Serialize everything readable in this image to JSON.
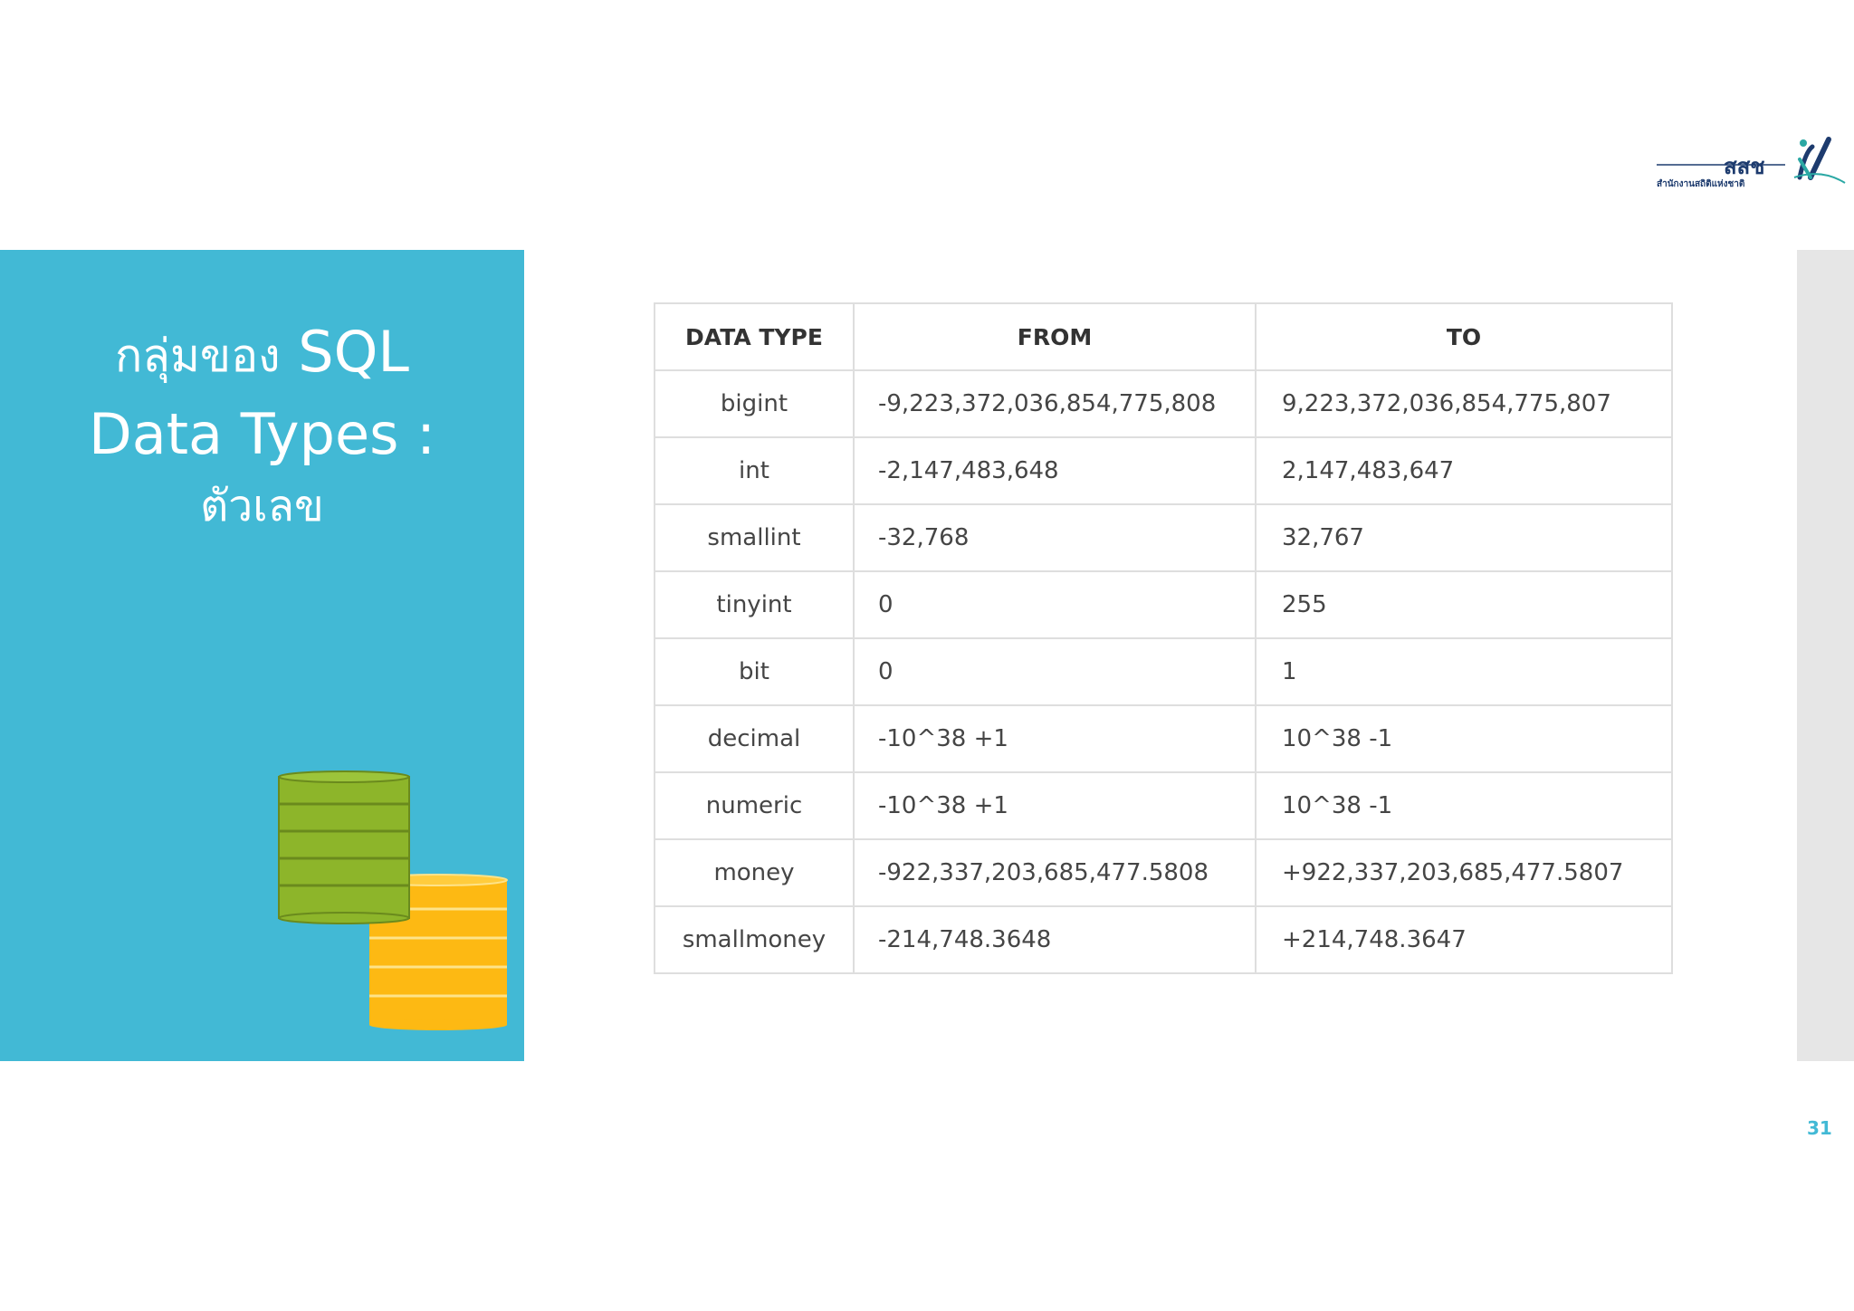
{
  "logo": {
    "text": "สสช",
    "subtitle": "สำนักงานสถิติแห่งชาติ",
    "icon": "nso-logo-icon"
  },
  "title": {
    "line1_thai": "กลุ่มของ",
    "line1_en": "SQL",
    "line2": "Data Types :",
    "line3": "ตัวเลข"
  },
  "table": {
    "headers": [
      "DATA TYPE",
      "FROM",
      "TO"
    ],
    "rows": [
      {
        "type": "bigint",
        "from": "-9,223,372,036,854,775,808",
        "to": "9,223,372,036,854,775,807"
      },
      {
        "type": "int",
        "from": "-2,147,483,648",
        "to": "2,147,483,647"
      },
      {
        "type": "smallint",
        "from": "-32,768",
        "to": "32,767"
      },
      {
        "type": "tinyint",
        "from": "0",
        "to": "255"
      },
      {
        "type": "bit",
        "from": "0",
        "to": "1"
      },
      {
        "type": "decimal",
        "from": "-10^38 +1",
        "to": "10^38 -1"
      },
      {
        "type": "numeric",
        "from": "-10^38 +1",
        "to": "10^38 -1"
      },
      {
        "type": "money",
        "from": "-922,337,203,685,477.5808",
        "to": "+922,337,203,685,477.5807"
      },
      {
        "type": "smallmoney",
        "from": "-214,748.3648",
        "to": "+214,748.3647"
      }
    ]
  },
  "page_number": "31",
  "colors": {
    "panel": "#42b9d5",
    "db_green": "#8db52a",
    "db_yellow": "#fdb913",
    "strip": "#e6e6e6"
  },
  "icons": {
    "database": "database-stack-icon"
  }
}
